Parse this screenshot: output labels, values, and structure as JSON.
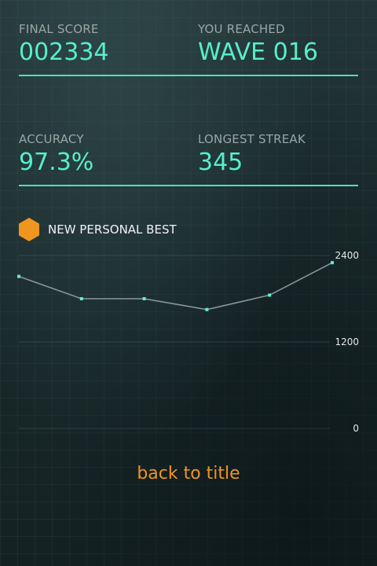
{
  "stats": {
    "final_score": {
      "label": "FINAL SCORE",
      "value": "002334"
    },
    "wave": {
      "label": "YOU REACHED",
      "value": "WAVE 016"
    },
    "accuracy": {
      "label": "ACCURACY",
      "value": "97.3%"
    },
    "streak": {
      "label": "LONGEST STREAK",
      "value": "345"
    }
  },
  "personal_best": {
    "icon": "hexagon-icon",
    "label": "NEW PERSONAL BEST",
    "color": "#f0951e"
  },
  "chart_data": {
    "type": "line",
    "values": [
      2110,
      1800,
      1800,
      1650,
      1850,
      2300
    ],
    "ylim": [
      0,
      2400
    ],
    "yticks": [
      2400,
      1200,
      0
    ],
    "grid": true,
    "line_color": "#8a9696",
    "point_color": "#5ef2d0"
  },
  "back_to_title": "back to title",
  "colors": {
    "accent": "#56efcb",
    "highlight": "#f0951e",
    "label": "#9aa6a5"
  }
}
